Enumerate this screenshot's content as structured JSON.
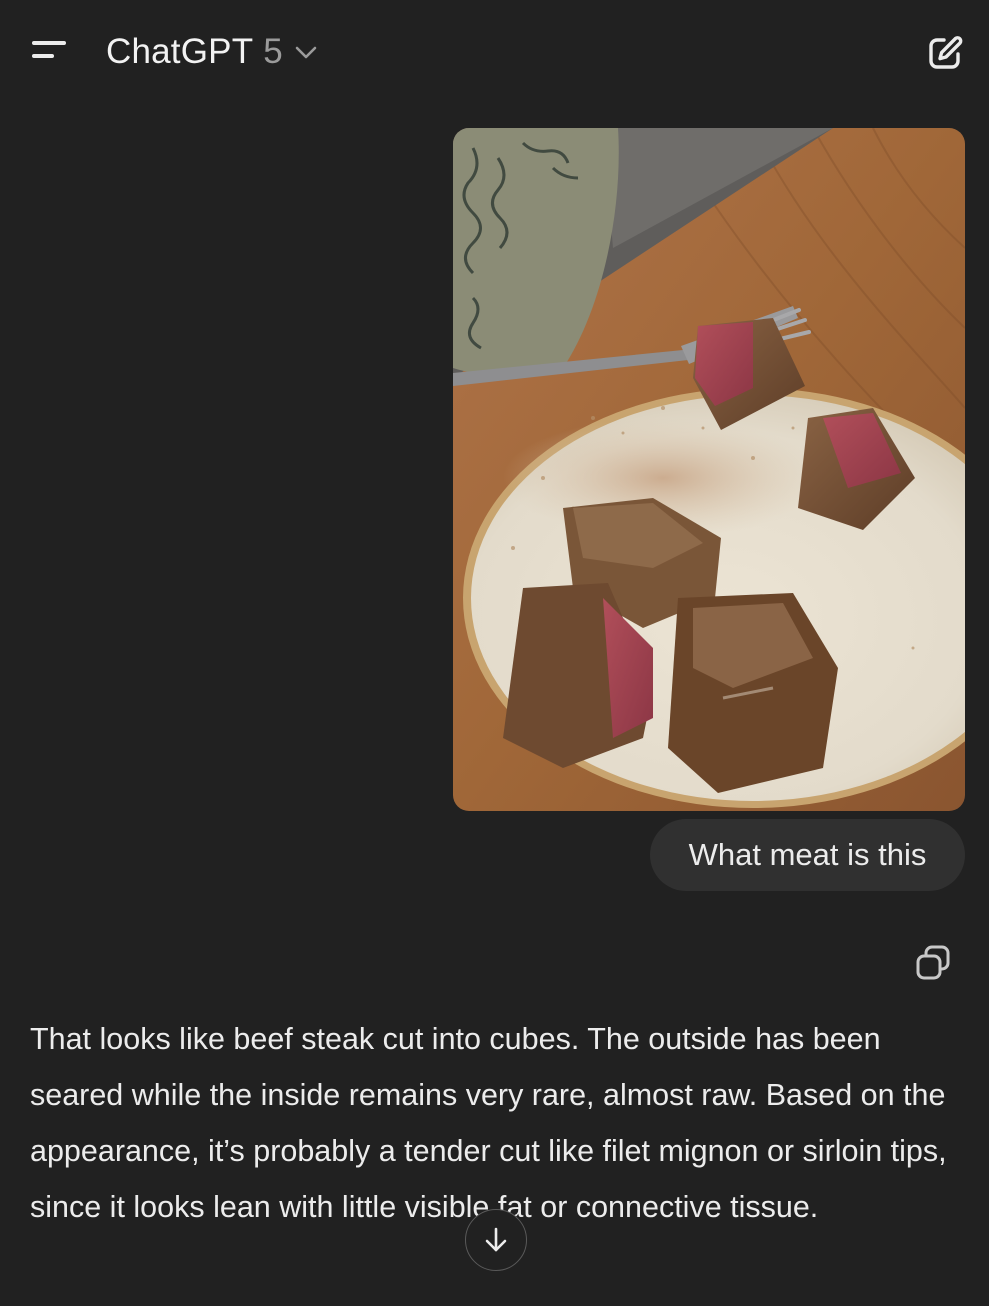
{
  "header": {
    "title": "ChatGPT",
    "model_version": "5",
    "menu_icon": "hamburger-menu-icon",
    "dropdown_icon": "chevron-down-icon",
    "new_chat_icon": "compose-icon"
  },
  "conversation": {
    "user_image_description_icon": "photo",
    "user_message": "What meat is this",
    "copy_icon": "copy-icon",
    "assistant_message": "That looks like beef steak cut into cubes. The outside has been seared while the inside remains very rare, almost raw. Based on the appearance, it’s probably a tender cut like filet mignon or sirloin tips, since it looks lean with little visible fat or connective tissue."
  },
  "controls": {
    "scroll_down_icon": "arrow-down-icon"
  },
  "colors": {
    "background": "#212121",
    "bubble": "#303030",
    "text": "#ececec",
    "muted": "#9b9b9b"
  }
}
